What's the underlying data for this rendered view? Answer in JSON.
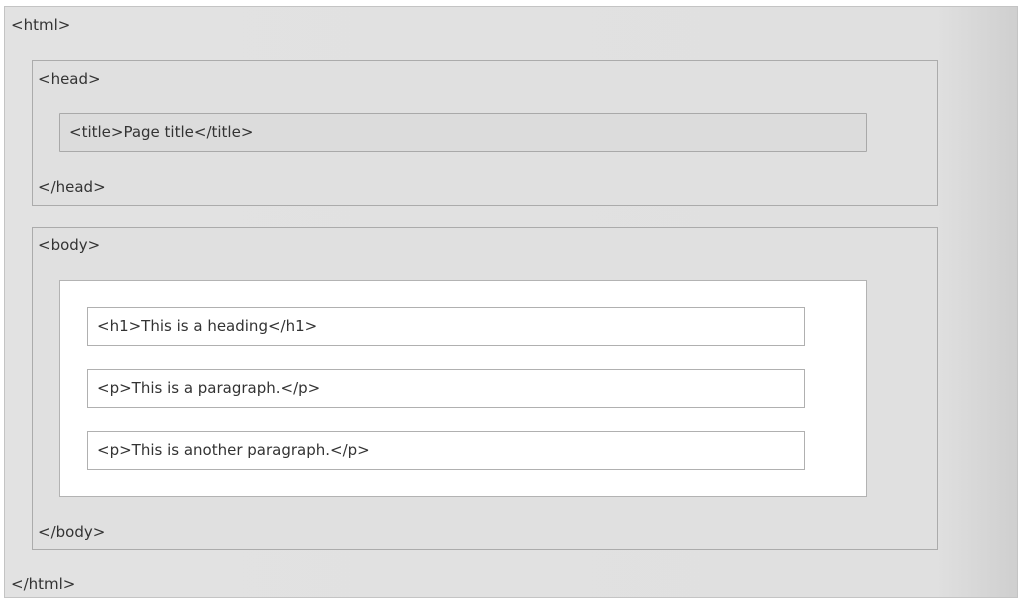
{
  "html_open": "<html>",
  "html_close": "</html>",
  "head": {
    "open": "<head>",
    "close": "</head>",
    "title_line": "<title>Page title</title>"
  },
  "body": {
    "open": "<body>",
    "close": "</body>",
    "lines": [
      "<h1>This is a heading</h1>",
      "<p>This is a paragraph.</p>",
      "<p>This is another paragraph.</p>"
    ]
  },
  "colors": {
    "background": "#e0e0e0",
    "border": "#ababab",
    "content_bg": "#ffffff",
    "text": "#333333"
  }
}
